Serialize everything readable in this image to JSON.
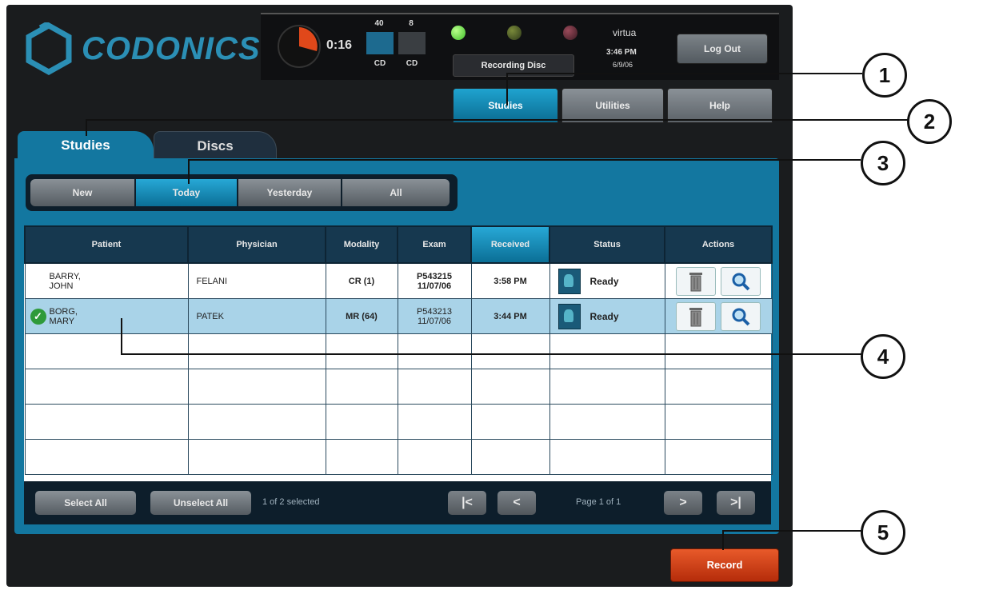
{
  "header": {
    "logo_text": "CODONICS",
    "timer": "0:16",
    "counts": [
      {
        "top": "40",
        "label": "CD",
        "color": "#1d6a8f"
      },
      {
        "top": "8",
        "label": "CD",
        "color": "#3a3e42"
      }
    ],
    "leds": [
      "#4fcf3a",
      "#4a5a2a",
      "#6a2a3a"
    ],
    "status_display": "Recording Disc",
    "system_name": "virtua",
    "system_time": "3:46 PM",
    "system_date": "6/9/06",
    "logout_label": "Log Out"
  },
  "main_tabs": [
    {
      "label": "Studies",
      "active": true
    },
    {
      "label": "Utilities",
      "active": false
    },
    {
      "label": "Help",
      "active": false
    }
  ],
  "sub_tabs": {
    "studies": "Studies",
    "discs": "Discs"
  },
  "filters": [
    {
      "label": "New",
      "active": false
    },
    {
      "label": "Today",
      "active": true
    },
    {
      "label": "Yesterday",
      "active": false
    },
    {
      "label": "All",
      "active": false
    }
  ],
  "table": {
    "headers": [
      "Patient",
      "Physician",
      "Modality",
      "Exam",
      "Received",
      "Status",
      "Actions"
    ],
    "rows": [
      {
        "patient_last": "BARRY,",
        "patient_first": "JOHN",
        "physician": "FELANI",
        "modality": "CR (1)",
        "exam_id": "P543215",
        "exam_date": "11/07/06",
        "received": "3:58 PM",
        "status": "Ready",
        "selected": false
      },
      {
        "patient_last": "BORG,",
        "patient_first": "MARY",
        "physician": "PATEK",
        "modality": "MR (64)",
        "exam_id": "P543213",
        "exam_date": "11/07/06",
        "received": "3:44 PM",
        "status": "Ready",
        "selected": true
      }
    ]
  },
  "bottom": {
    "select_all": "Select All",
    "unselect_all": "Unselect All",
    "selection_text": "1 of 2 selected",
    "page_text": "Page 1 of 1",
    "nav": {
      "first": "|<",
      "prev": "<",
      "next": ">",
      "last": ">|"
    }
  },
  "record_label": "Record",
  "callouts": [
    "1",
    "2",
    "3",
    "4",
    "5"
  ]
}
